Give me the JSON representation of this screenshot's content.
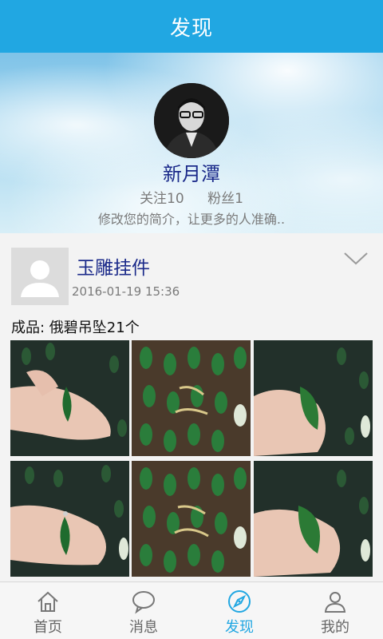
{
  "header": {
    "title": "发现"
  },
  "profile": {
    "name": "新月潭",
    "following_label": "关注10",
    "fans_label": "粉丝1",
    "bio": "修改您的简介，让更多的人准确.."
  },
  "post": {
    "title": "玉雕挂件",
    "time": "2016-01-19 15:36",
    "text": "成品: 俄碧吊坠21个",
    "photos": [
      "pendant-hand-photo-1",
      "pendant-display-photo-1",
      "pendant-hand-photo-2",
      "pendant-hand-photo-3",
      "pendant-display-photo-2",
      "pendant-hand-photo-4"
    ]
  },
  "tabs": [
    {
      "label": "首页",
      "icon": "home-icon",
      "active": false
    },
    {
      "label": "消息",
      "icon": "message-icon",
      "active": false
    },
    {
      "label": "发现",
      "icon": "compass-icon",
      "active": true
    },
    {
      "label": "我的",
      "icon": "user-icon",
      "active": false
    }
  ],
  "colors": {
    "accent": "#21a7e2",
    "name_blue": "#1b2a8a"
  }
}
